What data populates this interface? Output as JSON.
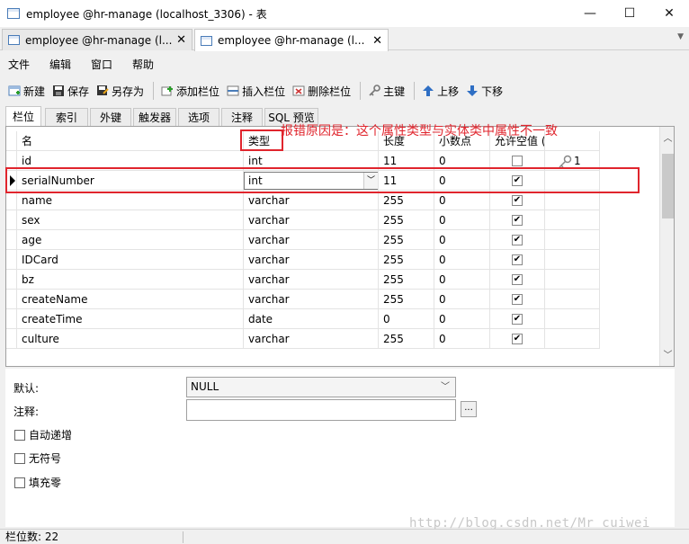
{
  "window": {
    "title": "employee @hr-manage (localhost_3306) - 表",
    "minimize": "—",
    "maximize": "☐",
    "close": "✕"
  },
  "doc_tabs": [
    {
      "label": "employee @hr-manage (l...",
      "close": "✕"
    },
    {
      "label": "employee @hr-manage (l...",
      "close": "✕"
    }
  ],
  "tab_scroll": "▼",
  "menu": [
    "文件",
    "编辑",
    "窗口",
    "帮助"
  ],
  "toolbar": {
    "new": "新建",
    "save": "保存",
    "save_as": "另存为",
    "add_field": "添加栏位",
    "insert_field": "插入栏位",
    "delete_field": "删除栏位",
    "primary_key": "主键",
    "move_up": "上移",
    "move_down": "下移"
  },
  "sub_tabs": [
    "栏位",
    "索引",
    "外键",
    "触发器",
    "选项",
    "注释",
    "SQL 预览"
  ],
  "columns": {
    "name": "名",
    "type": "类型",
    "length": "长度",
    "decimals": "小数点",
    "allow_null": "允许空值 ("
  },
  "fields": [
    {
      "name": "id",
      "type": "int",
      "length": "11",
      "decimals": "0",
      "allow_null": false,
      "key": "1"
    },
    {
      "name": "serialNumber",
      "type": "int",
      "length": "11",
      "decimals": "0",
      "allow_null": true,
      "key": ""
    },
    {
      "name": "name",
      "type": "varchar",
      "length": "255",
      "decimals": "0",
      "allow_null": true,
      "key": ""
    },
    {
      "name": "sex",
      "type": "varchar",
      "length": "255",
      "decimals": "0",
      "allow_null": true,
      "key": ""
    },
    {
      "name": "age",
      "type": "varchar",
      "length": "255",
      "decimals": "0",
      "allow_null": true,
      "key": ""
    },
    {
      "name": "IDCard",
      "type": "varchar",
      "length": "255",
      "decimals": "0",
      "allow_null": true,
      "key": ""
    },
    {
      "name": "bz",
      "type": "varchar",
      "length": "255",
      "decimals": "0",
      "allow_null": true,
      "key": ""
    },
    {
      "name": "createName",
      "type": "varchar",
      "length": "255",
      "decimals": "0",
      "allow_null": true,
      "key": ""
    },
    {
      "name": "createTime",
      "type": "date",
      "length": "0",
      "decimals": "0",
      "allow_null": true,
      "key": ""
    },
    {
      "name": "culture",
      "type": "varchar",
      "length": "255",
      "decimals": "0",
      "allow_null": true,
      "key": ""
    }
  ],
  "selected_row": 1,
  "annotation": "报错原因是：这个属性类型与实体类中属性不一致",
  "properties": {
    "default_label": "默认:",
    "default_value": "NULL",
    "comment_label": "注释:",
    "comment_value": "",
    "ellipsis": "...",
    "auto_increment": "自动递增",
    "unsigned": "无符号",
    "zerofill": "填充零"
  },
  "status": {
    "field_count": "栏位数: 22"
  },
  "watermark": "http://blog.csdn.net/Mr_cuiwei",
  "colors": {
    "highlight": "#e0252d"
  }
}
